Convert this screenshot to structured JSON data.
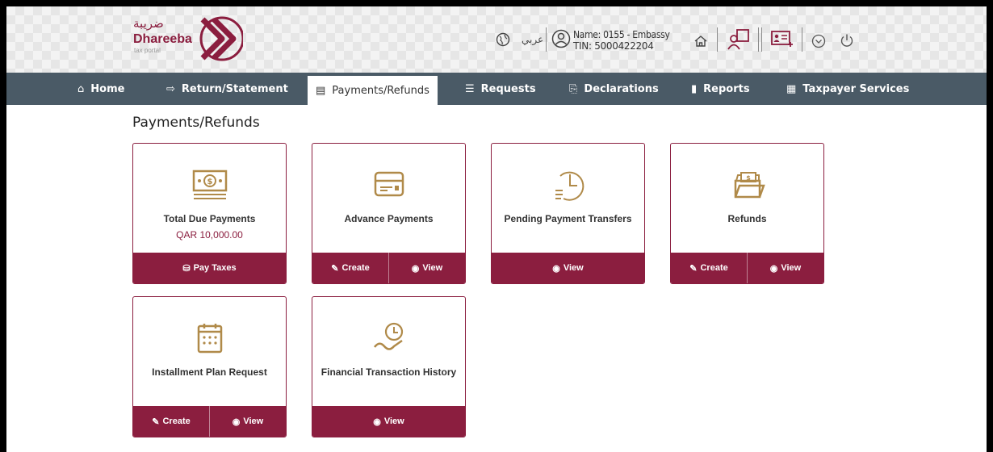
{
  "brand": {
    "arabic_name": "ضريبة",
    "name": "Dhareeba",
    "subtitle": "tax portal",
    "color": "#8b1e3f"
  },
  "header": {
    "language_link": "عربي",
    "user_name": "Name: 0155 - Embassy",
    "user_tin": "TIN: 5000422204",
    "icons": [
      "globe-icon",
      "user-icon",
      "home-icon",
      "users-icon",
      "id-card-icon",
      "chevron-down-icon",
      "power-icon"
    ]
  },
  "nav": {
    "items": [
      {
        "label": "Home",
        "icon": "home-icon"
      },
      {
        "label": "Return/Statement",
        "icon": "return-icon"
      },
      {
        "label": "Payments/Refunds",
        "icon": "payments-icon",
        "active": true
      },
      {
        "label": "Requests",
        "icon": "requests-icon"
      },
      {
        "label": "Declarations",
        "icon": "declarations-icon"
      },
      {
        "label": "Reports",
        "icon": "reports-icon"
      },
      {
        "label": "Taxpayer Services",
        "icon": "services-icon"
      }
    ],
    "background": "#4a5a66"
  },
  "page": {
    "title": "Payments/Refunds"
  },
  "cards": [
    {
      "title": "Total Due Payments",
      "subtitle": "QAR 10,000.00",
      "icon": "cash-icon",
      "actions": [
        "Pay Taxes"
      ]
    },
    {
      "title": "Advance Payments",
      "icon": "card-icon",
      "actions": [
        "Create",
        "View"
      ]
    },
    {
      "title": "Pending Payment Transfers",
      "icon": "clock-list-icon",
      "actions": [
        "View"
      ]
    },
    {
      "title": "Refunds",
      "icon": "wallet-icon",
      "actions": [
        "Create",
        "View"
      ]
    },
    {
      "title": "Installment Plan Request",
      "icon": "calendar-icon",
      "actions": [
        "Create",
        "View"
      ]
    },
    {
      "title": "Financial Transaction History",
      "icon": "history-icon",
      "actions": [
        "View"
      ]
    }
  ]
}
